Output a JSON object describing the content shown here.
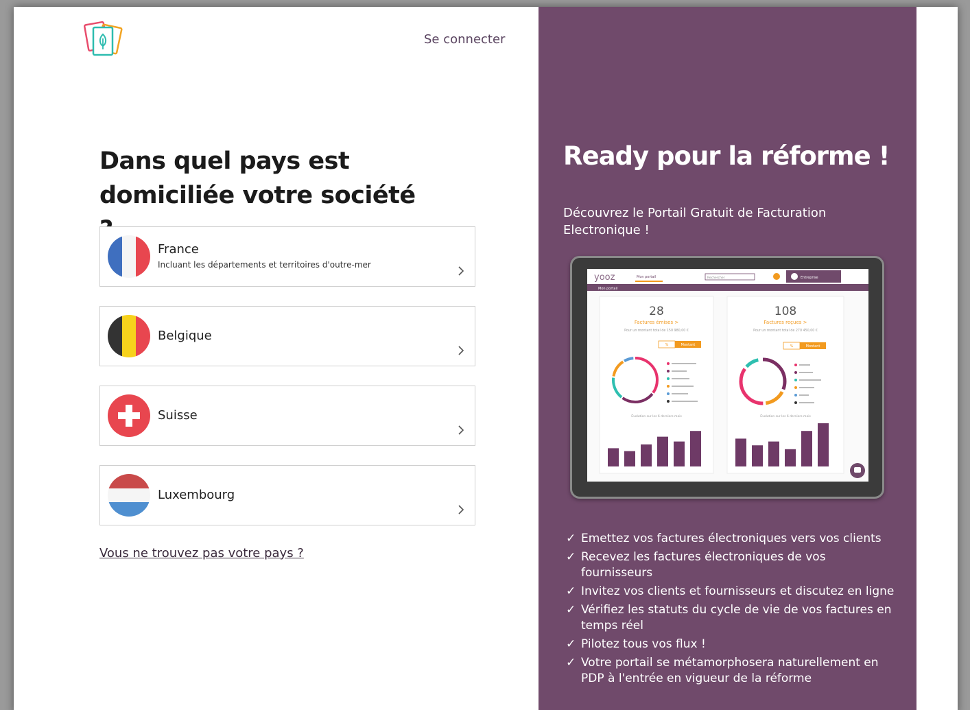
{
  "header": {
    "signin_label": "Se connecter"
  },
  "question": "Dans quel pays est domiciliée votre société ?",
  "countries": [
    {
      "name": "France",
      "subtitle": "Incluant les départements et territoires d'outre-mer",
      "flag_icon": "flag-france-icon"
    },
    {
      "name": "Belgique",
      "flag_icon": "flag-belgium-icon"
    },
    {
      "name": "Suisse",
      "flag_icon": "flag-switzerland-icon"
    },
    {
      "name": "Luxembourg",
      "flag_icon": "flag-luxembourg-icon"
    }
  ],
  "not_found_link": "Vous ne trouvez pas votre pays ?",
  "promo": {
    "title": "Ready pour la réforme !",
    "subtitle": "Découvrez le Portail Gratuit de Facturation Electronique !",
    "features": [
      "Emettez vos factures électroniques vers vos clients",
      "Recevez les factures électroniques de vos fournisseurs",
      "Invitez vos clients et fournisseurs et discutez en ligne",
      "Vérifiez les statuts du cycle de vie de vos factures en temps réel",
      "Pilotez tous vos flux !",
      "Votre portail se métamorphosera naturellement en PDP à l'entrée en vigueur de la réforme"
    ],
    "check_glyph": "✓"
  },
  "tablet_mockup": {
    "brand": "yooz",
    "tab": "Mon portail",
    "breadcrumb": "Mon portail",
    "search_placeholder": "Rechercher",
    "user": "Entreprise",
    "cards": [
      {
        "count": "28",
        "label": "Factures émises >",
        "amount_text": "Pour un montant total de 150 980,00 €",
        "toggle": [
          "%",
          "Montant"
        ],
        "bars": [
          0.38,
          0.32,
          0.46,
          0.62,
          0.52,
          0.74
        ]
      },
      {
        "count": "108",
        "label": "Factures reçues >",
        "amount_text": "Pour un montant total de 270 450,00 €",
        "toggle": [
          "%",
          "Montant"
        ],
        "bars": [
          0.58,
          0.44,
          0.52,
          0.36,
          0.74,
          0.9
        ]
      }
    ],
    "chart_caption": "Évolution sur les 6 derniers mois"
  },
  "colors": {
    "panel": "#704a6b",
    "accent_orange": "#f29a1f",
    "donut": [
      "#e8336d",
      "#7b2f63",
      "#2ebfb0",
      "#f29a1f",
      "#5b9bd5"
    ]
  }
}
